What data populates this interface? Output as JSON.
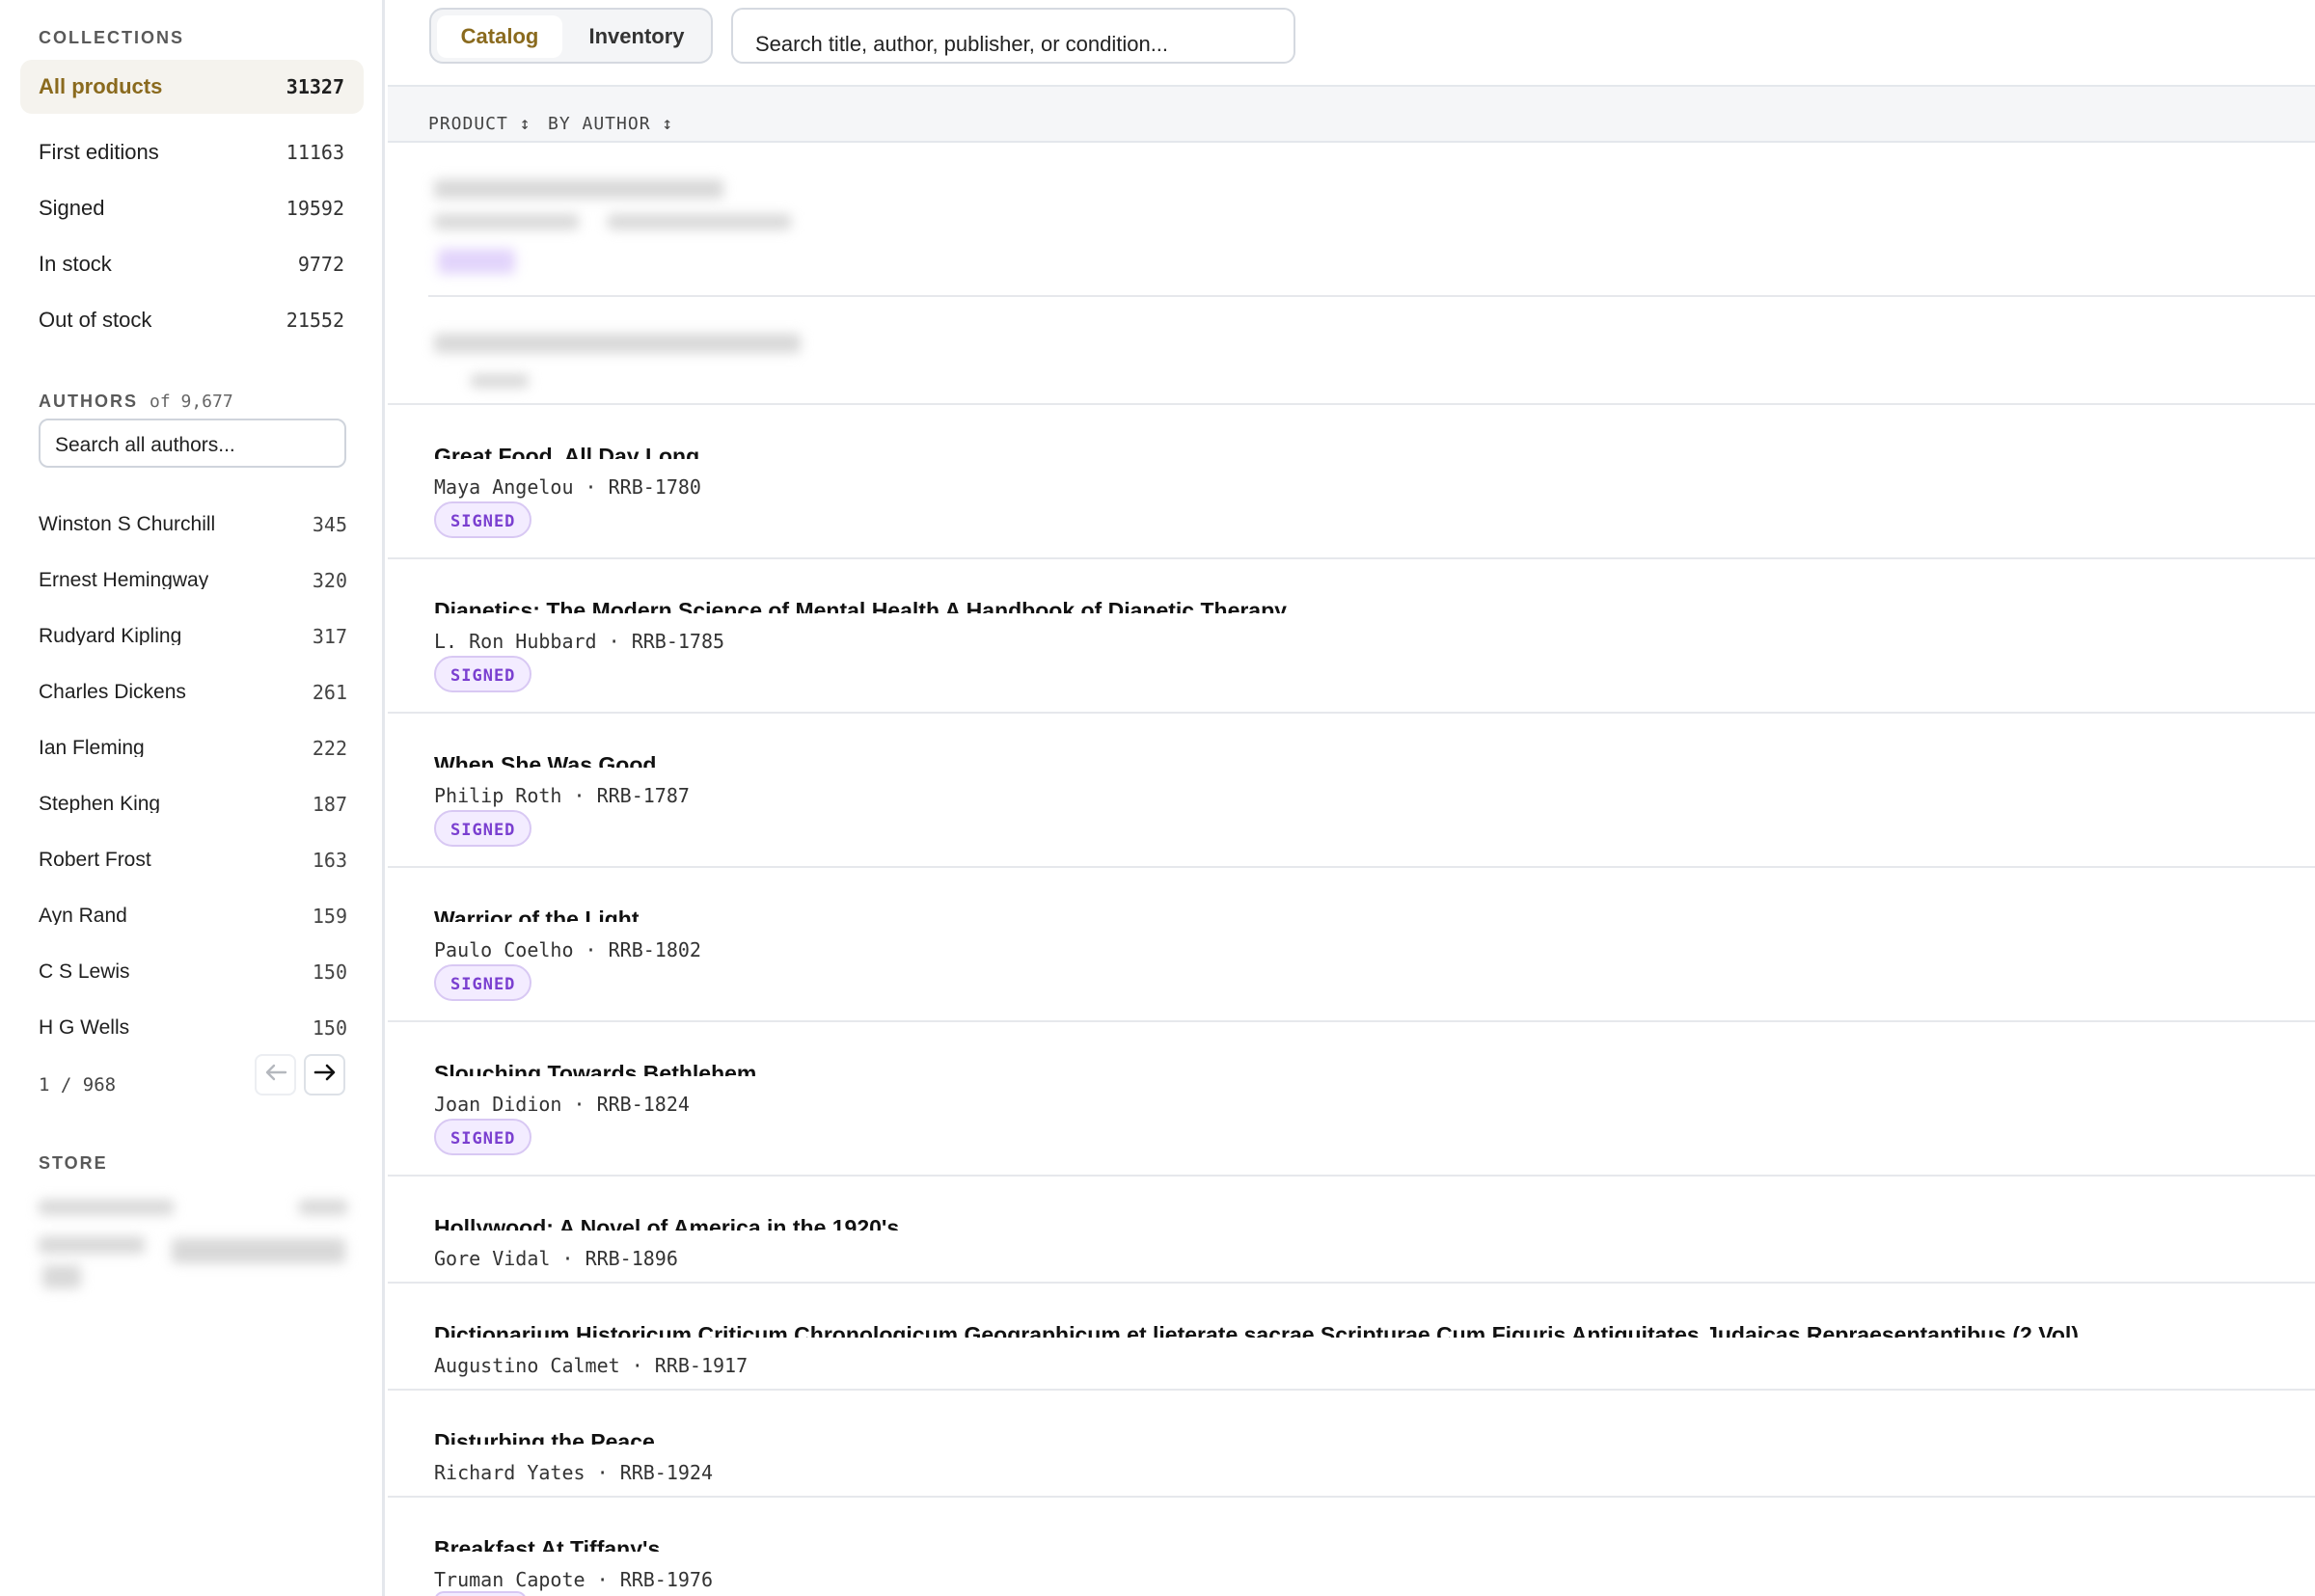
{
  "sidebar": {
    "collections_heading": "COLLECTIONS",
    "collections": [
      {
        "label": "All products",
        "count": "31327",
        "active": true
      },
      {
        "label": "First editions",
        "count": "11163"
      },
      {
        "label": "Signed",
        "count": "19592"
      },
      {
        "label": "In stock",
        "count": "9772"
      },
      {
        "label": "Out of stock",
        "count": "21552"
      }
    ],
    "authors_heading": "AUTHORS",
    "authors_of": "of 9,677",
    "authors_search_placeholder": "Search all authors...",
    "authors": [
      {
        "name": "Winston S Churchill",
        "count": "345"
      },
      {
        "name": "Ernest Hemingway",
        "count": "320"
      },
      {
        "name": "Rudyard Kipling",
        "count": "317"
      },
      {
        "name": "Charles Dickens",
        "count": "261"
      },
      {
        "name": "Ian Fleming",
        "count": "222"
      },
      {
        "name": "Stephen King",
        "count": "187"
      },
      {
        "name": "Robert Frost",
        "count": "163"
      },
      {
        "name": "Ayn Rand",
        "count": "159"
      },
      {
        "name": "C S Lewis",
        "count": "150"
      },
      {
        "name": "H G Wells",
        "count": "150"
      }
    ],
    "pager_text": "1 / 968",
    "pager_prev_icon": "arrow-left-icon",
    "pager_next_icon": "arrow-right-icon",
    "store_heading": "STORE"
  },
  "topbar": {
    "tabs": [
      {
        "label": "Catalog",
        "active": true
      },
      {
        "label": "Inventory"
      }
    ],
    "search_placeholder": "Search title, author, publisher, or condition..."
  },
  "table": {
    "headers": [
      "PRODUCT ↕",
      "BY AUTHOR ↕"
    ],
    "rows": [
      {
        "title": "Great Food, All Day Long",
        "author": "Maya Angelou",
        "sku": "RRB-1780",
        "badge": "SIGNED"
      },
      {
        "title": "Dianetics: The Modern Science of Mental Health A Handbook of Dianetic Therapy",
        "author": "L. Ron Hubbard",
        "sku": "RRB-1785",
        "badge": "SIGNED"
      },
      {
        "title": "When She Was Good",
        "author": "Philip Roth",
        "sku": "RRB-1787",
        "badge": "SIGNED"
      },
      {
        "title": "Warrior of the Light",
        "author": "Paulo Coelho",
        "sku": "RRB-1802",
        "badge": "SIGNED"
      },
      {
        "title": "Slouching Towards Bethlehem",
        "author": "Joan Didion",
        "sku": "RRB-1824",
        "badge": "SIGNED"
      },
      {
        "title": "Hollywood: A Novel of America in the 1920's",
        "author": "Gore Vidal",
        "sku": "RRB-1896"
      },
      {
        "title": "Dictionarium Historicum Criticum Chronologicum Geographicum et lieterate sacrae Scripturae Cum Figuris Antiquitates Judaicas Repraesentantibus (2 Vol)",
        "author": "Augustino Calmet",
        "sku": "RRB-1917"
      },
      {
        "title": "Disturbing the Peace",
        "author": "Richard Yates",
        "sku": "RRB-1924"
      },
      {
        "title": "Breakfast At Tiffany's",
        "author": "Truman Capote",
        "sku": "RRB-1976"
      }
    ],
    "meta_separator": "·"
  },
  "colors": {
    "accent": "#8a6a1e",
    "badge_text": "#7a3fd0",
    "badge_bg": "#f3ecff",
    "divider": "#e4e7ec"
  }
}
